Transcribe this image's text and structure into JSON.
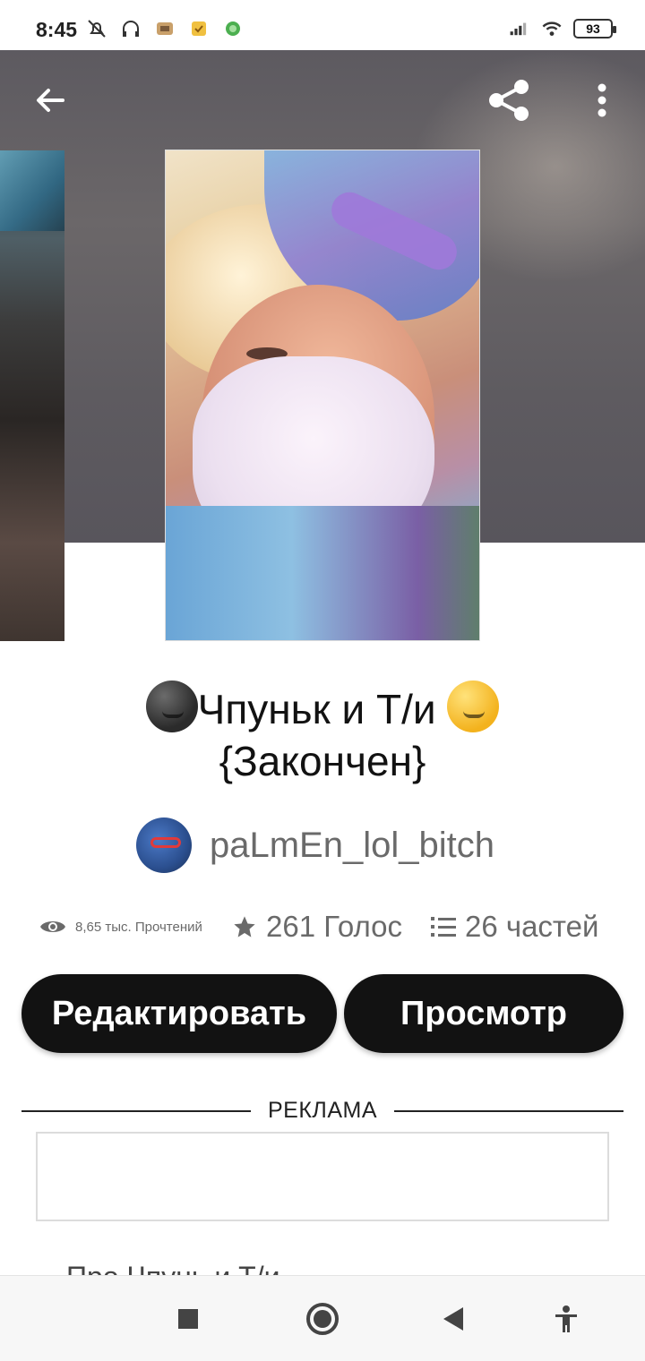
{
  "status_bar": {
    "time": "8:45",
    "battery": "93",
    "left_icons": [
      "muted-bell-icon",
      "headphones-icon",
      "app-notification-icon",
      "app-notification-icon",
      "app-notification-icon"
    ],
    "right_icons": [
      "signal-icon",
      "wifi-icon",
      "battery-icon"
    ]
  },
  "header": {
    "back_icon": "arrow-left-icon",
    "share_icon": "share-icon",
    "more_icon": "more-vertical-icon"
  },
  "story": {
    "title_line1": "Чпуньк и Т/и",
    "title_line2": "{Закончен}",
    "author": "paLmEn_lol_bitch",
    "stats": {
      "reads": "8,65 тыс. Прочтений",
      "votes": "261 Голос",
      "parts": "26 частей"
    }
  },
  "actions": {
    "edit_label": "Редактировать",
    "view_label": "Просмотр"
  },
  "ads": {
    "label": "РЕКЛАМА"
  },
  "about_heading_partial": "Про Чпунь и Т/и",
  "nav_bar": {
    "icons": [
      "square-recents-icon",
      "circle-home-icon",
      "triangle-back-icon",
      "accessibility-icon"
    ]
  },
  "colors": {
    "button_bg": "#121212",
    "button_text": "#ffffff",
    "muted_text": "#6a6a6a",
    "cover_bg": "#5e5b60"
  }
}
